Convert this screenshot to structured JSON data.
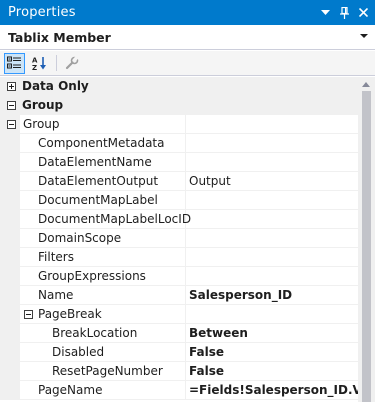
{
  "window": {
    "title": "Properties",
    "icons": [
      "dropdown-arrow-icon",
      "pin-icon",
      "close-icon"
    ]
  },
  "object_selector": {
    "value": "Tablix Member"
  },
  "toolbar": {
    "buttons": [
      "categorized-icon",
      "alphabetical-icon",
      "property-pages-icon"
    ]
  },
  "grid": {
    "rows": [
      {
        "type": "category",
        "expanded": false,
        "label": "Data Only"
      },
      {
        "type": "category",
        "expanded": true,
        "label": "Group"
      },
      {
        "type": "property",
        "expander": "minus",
        "level": 0,
        "label": "Group",
        "value": ""
      },
      {
        "type": "property",
        "level": 1,
        "label": "ComponentMetadata",
        "value": ""
      },
      {
        "type": "property",
        "level": 1,
        "label": "DataElementName",
        "value": ""
      },
      {
        "type": "property",
        "level": 1,
        "label": "DataElementOutput",
        "value": "Output",
        "bold": false
      },
      {
        "type": "property",
        "level": 1,
        "label": "DocumentMapLabel",
        "value": ""
      },
      {
        "type": "property",
        "level": 1,
        "label": "DocumentMapLabelLocID",
        "value": ""
      },
      {
        "type": "property",
        "level": 1,
        "label": "DomainScope",
        "value": ""
      },
      {
        "type": "property",
        "level": 1,
        "label": "Filters",
        "value": ""
      },
      {
        "type": "property",
        "level": 1,
        "label": "GroupExpressions",
        "value": ""
      },
      {
        "type": "property",
        "level": 1,
        "label": "Name",
        "value": "Salesperson_ID",
        "bold": true
      },
      {
        "type": "property",
        "expander": "minus",
        "level": 1,
        "label": "PageBreak",
        "value": ""
      },
      {
        "type": "property",
        "level": 2,
        "label": "BreakLocation",
        "value": "Between",
        "bold": true
      },
      {
        "type": "property",
        "level": 2,
        "label": "Disabled",
        "value": "False",
        "bold": true
      },
      {
        "type": "property",
        "level": 2,
        "label": "ResetPageNumber",
        "value": "False",
        "bold": true
      },
      {
        "type": "property",
        "level": 1,
        "label": "PageName",
        "value": "=Fields!Salesperson_ID.Value",
        "bold": true
      }
    ]
  }
}
